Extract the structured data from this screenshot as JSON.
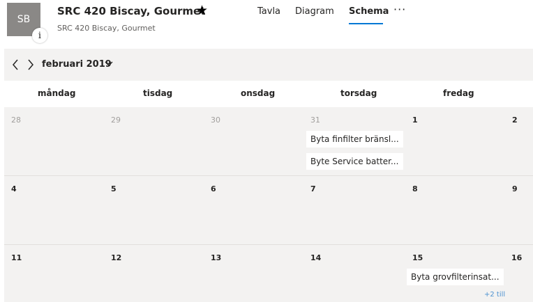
{
  "header": {
    "avatar_initials": "SB",
    "info_glyph": "i",
    "title": "SRC 420 Biscay, Gourmet",
    "favorite_glyph": "★",
    "subtitle": "SRC 420 Biscay, Gourmet",
    "tabs": [
      {
        "label": "Tavla",
        "active": false
      },
      {
        "label": "Diagram",
        "active": false
      },
      {
        "label": "Schema",
        "active": true
      }
    ],
    "more_label": "···",
    "accent_color": "#0078d4"
  },
  "calendar": {
    "month_label": "februari 2019",
    "prev_icon": "chevron-left-icon",
    "next_icon": "chevron-right-icon",
    "month_dropdown_icon": "chevron-down-icon",
    "day_names": [
      "måndag",
      "tisdag",
      "onsdag",
      "torsdag",
      "fredag"
    ],
    "weeks": [
      {
        "dates": [
          {
            "label": "28",
            "in_month": false
          },
          {
            "label": "29",
            "in_month": false
          },
          {
            "label": "30",
            "in_month": false
          },
          {
            "label": "31",
            "in_month": false
          },
          {
            "label": "1",
            "in_month": true
          },
          {
            "label": "2",
            "in_month": true
          }
        ],
        "events": [
          "Byta finfilter bränsl...",
          "Byte Service batter..."
        ],
        "event_day_index": 3
      },
      {
        "dates": [
          {
            "label": "4",
            "in_month": true
          },
          {
            "label": "5",
            "in_month": true
          },
          {
            "label": "6",
            "in_month": true
          },
          {
            "label": "7",
            "in_month": true
          },
          {
            "label": "8",
            "in_month": true
          },
          {
            "label": "9",
            "in_month": true
          }
        ],
        "events": [],
        "event_day_index": null
      },
      {
        "dates": [
          {
            "label": "11",
            "in_month": true
          },
          {
            "label": "12",
            "in_month": true
          },
          {
            "label": "13",
            "in_month": true
          },
          {
            "label": "14",
            "in_month": true
          },
          {
            "label": "15",
            "in_month": true
          },
          {
            "label": "16",
            "in_month": true
          }
        ],
        "events": [
          "Byta grovfilterinsat..."
        ],
        "event_day_index": 4,
        "more_label": "+2 till"
      }
    ]
  }
}
